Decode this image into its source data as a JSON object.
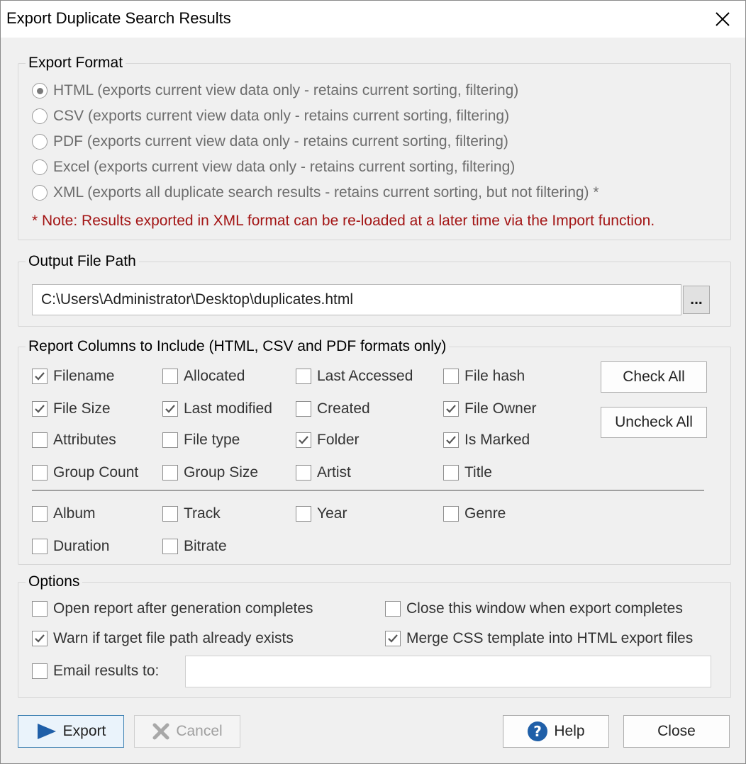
{
  "window": {
    "title": "Export Duplicate Search Results"
  },
  "export_format": {
    "legend": "Export Format",
    "options": [
      {
        "label": "HTML (exports current view data only - retains current sorting, filtering)",
        "selected": true
      },
      {
        "label": "CSV (exports current view data only - retains current sorting, filtering)",
        "selected": false
      },
      {
        "label": "PDF (exports current view data only - retains current sorting, filtering)",
        "selected": false
      },
      {
        "label": "Excel (exports current view data only - retains current sorting, filtering)",
        "selected": false
      },
      {
        "label": "XML (exports all duplicate search results - retains current sorting, but not filtering) *",
        "selected": false
      }
    ],
    "note": "* Note: Results exported in XML format can be re-loaded at a later time via the Import function."
  },
  "output": {
    "legend": "Output File Path",
    "path": "C:\\Users\\Administrator\\Desktop\\duplicates.html",
    "browse_label": "..."
  },
  "columns": {
    "legend": "Report Columns to Include (HTML, CSV and PDF formats only)",
    "items": [
      {
        "label": "Filename",
        "checked": true
      },
      {
        "label": "Allocated",
        "checked": false
      },
      {
        "label": "Last Accessed",
        "checked": false
      },
      {
        "label": "File hash",
        "checked": false
      },
      {
        "label": "File Size",
        "checked": true
      },
      {
        "label": "Last modified",
        "checked": true
      },
      {
        "label": "Created",
        "checked": false
      },
      {
        "label": "File Owner",
        "checked": true
      },
      {
        "label": "Attributes",
        "checked": false
      },
      {
        "label": "File type",
        "checked": false
      },
      {
        "label": "Folder",
        "checked": true
      },
      {
        "label": "Is Marked",
        "checked": true
      },
      {
        "label": "Group Count",
        "checked": false
      },
      {
        "label": "Group Size",
        "checked": false
      },
      {
        "label": "Artist",
        "checked": false
      },
      {
        "label": "Title",
        "checked": false
      },
      {
        "label": "Album",
        "checked": false
      },
      {
        "label": "Track",
        "checked": false
      },
      {
        "label": "Year",
        "checked": false
      },
      {
        "label": "Genre",
        "checked": false
      },
      {
        "label": "Duration",
        "checked": false
      },
      {
        "label": "Bitrate",
        "checked": false
      }
    ],
    "check_all_label": "Check All",
    "uncheck_all_label": "Uncheck All"
  },
  "options": {
    "legend": "Options",
    "items": [
      {
        "label": "Open report after generation completes",
        "checked": false
      },
      {
        "label": "Close this window when export completes",
        "checked": false
      },
      {
        "label": "Warn if target file path already exists",
        "checked": true
      },
      {
        "label": "Merge CSS template into HTML export files",
        "checked": true
      },
      {
        "label": "Email results to:",
        "checked": false
      }
    ],
    "email_value": ""
  },
  "buttons": {
    "export": "Export",
    "cancel": "Cancel",
    "help": "Help",
    "close": "Close"
  },
  "colors": {
    "note": "#a31515",
    "accent": "#1f5fa8"
  }
}
